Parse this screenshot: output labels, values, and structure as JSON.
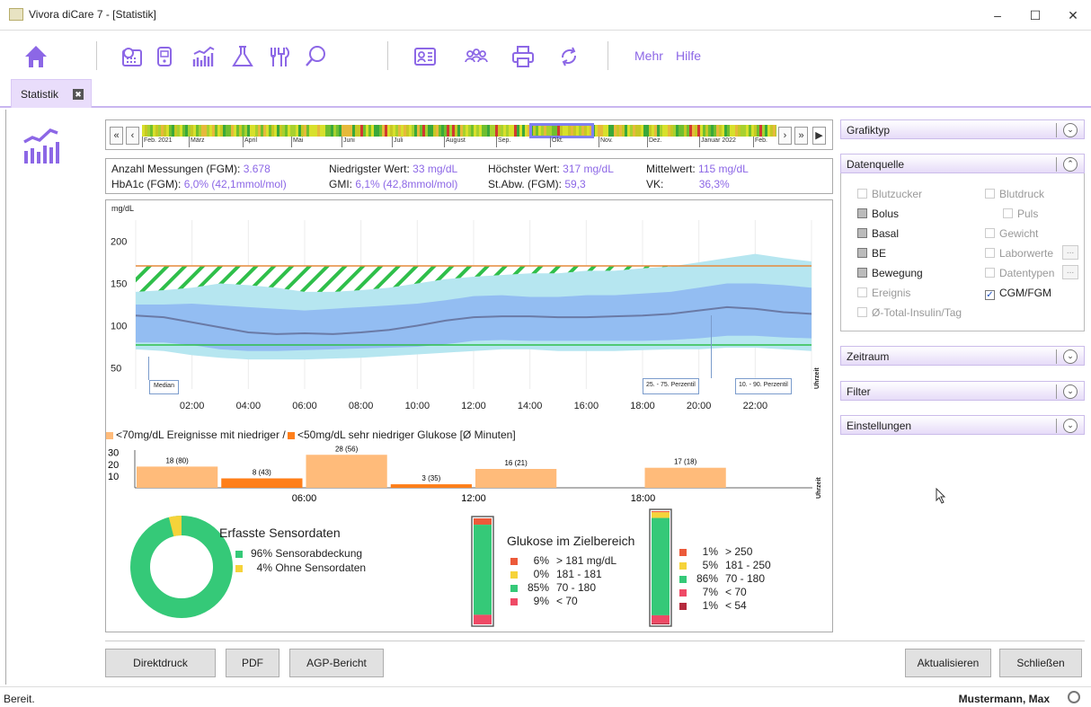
{
  "window": {
    "title": "Vivora diCare 7 - [Statistik]",
    "min": "–",
    "max": "☐",
    "close": "✕"
  },
  "toolbar": {
    "more": "Mehr",
    "help": "Hilfe"
  },
  "tab": {
    "label": "Statistik",
    "close": "✖"
  },
  "timeline": {
    "months": [
      "Feb. 2021",
      "März",
      "April",
      "Mai",
      "Juni",
      "Juli",
      "August",
      "Sep.",
      "Okt.",
      "Nov.",
      "Dez.",
      "Januar 2022",
      "Feb."
    ],
    "first": "«",
    "prev": "‹",
    "next": "›",
    "last": "»",
    "play": "▶"
  },
  "stats": {
    "count_label": "Anzahl Messungen (FGM):",
    "count_val": "3.678",
    "low_label": "Niedrigster Wert:",
    "low_val": "33 mg/dL",
    "high_label": "Höchster Wert:",
    "high_val": "317 mg/dL",
    "mean_label": "Mittelwert:",
    "mean_val": "115 mg/dL",
    "hba1c_label": "HbA1c (FGM):",
    "hba1c_val": "6,0% (42,1mmol/mol)",
    "gmi_label": "GMI:",
    "gmi_val": "6,1% (42,8mmol/mol)",
    "sd_label": "St.Abw. (FGM):",
    "sd_val": "59,3",
    "vk_label": "VK:",
    "vk_val": "36,3%"
  },
  "agp": {
    "unit": "mg/dL",
    "yticks": [
      "200",
      "150",
      "100",
      "50"
    ],
    "xticks": [
      "02:00",
      "04:00",
      "06:00",
      "08:00",
      "10:00",
      "12:00",
      "14:00",
      "16:00",
      "18:00",
      "20:00",
      "22:00"
    ],
    "xunit": "Uhrzeit",
    "median_label": "Median",
    "p25_label": "25. - 75. Perzentil",
    "p10_label": "10. - 90. Perzentil"
  },
  "events": {
    "legend1": "<70mg/dL Ereignisse mit niedriger /",
    "legend2": "<50mg/dL sehr niedriger Glukose [Ø Minuten]",
    "yticks": [
      "30",
      "20",
      "10"
    ],
    "xticks": [
      "06:00",
      "12:00",
      "18:00"
    ],
    "xunit": "Uhrzeit",
    "bars": [
      {
        "label": "18 (80)",
        "value": 18,
        "type": "low"
      },
      {
        "label": "8 (43)",
        "value": 8,
        "type": "verylow"
      },
      {
        "label": "28 (56)",
        "value": 28,
        "type": "low"
      },
      {
        "label": "3 (35)",
        "value": 3,
        "type": "verylow"
      },
      {
        "label": "16 (21)",
        "value": 16,
        "type": "low"
      },
      {
        "label": "17 (18)",
        "value": 17,
        "type": "low"
      }
    ]
  },
  "sensor": {
    "title": "Erfasste Sensordaten",
    "covered_pct": "96%",
    "covered_label": "Sensorabdeckung",
    "missing_pct": "4%",
    "missing_label": "Ohne Sensordaten",
    "covered_value": 96,
    "missing_value": 4
  },
  "target": {
    "title": "Glukose im Zielbereich",
    "left": [
      {
        "pct": "6%",
        "range": "> 181 mg/dL",
        "color": "#ec5a3a",
        "value": 6
      },
      {
        "pct": "0%",
        "range": "181 - 181",
        "color": "#f6d33a",
        "value": 0
      },
      {
        "pct": "85%",
        "range": "70 - 180",
        "color": "#35c978",
        "value": 85
      },
      {
        "pct": "9%",
        "range": "< 70",
        "color": "#ef4a66",
        "value": 9
      }
    ],
    "right": [
      {
        "pct": "1%",
        "range": "> 250",
        "color": "#ec5a3a",
        "value": 1
      },
      {
        "pct": "5%",
        "range": "181 - 250",
        "color": "#f6d33a",
        "value": 5
      },
      {
        "pct": "86%",
        "range": "70 - 180",
        "color": "#35c978",
        "value": 86
      },
      {
        "pct": "7%",
        "range": "< 70",
        "color": "#ef4a66",
        "value": 7
      },
      {
        "pct": "1%",
        "range": "< 54",
        "color": "#b52a3d",
        "value": 1
      }
    ]
  },
  "panel": {
    "grafiktyp": "Grafiktyp",
    "datenquelle": "Datenquelle",
    "zeitraum": "Zeitraum",
    "filter": "Filter",
    "einstellungen": "Einstellungen",
    "cb": {
      "blutzucker": "Blutzucker",
      "blutdruck": "Blutdruck",
      "bolus": "Bolus",
      "puls": "Puls",
      "basal": "Basal",
      "gewicht": "Gewicht",
      "be": "BE",
      "laborwerte": "Laborwerte",
      "bewegung": "Bewegung",
      "datentypen": "Datentypen",
      "ereignis": "Ereignis",
      "cgm": "CGM/FGM",
      "insulin": "Ø-Total-Insulin/Tag"
    },
    "dots": "...",
    "checkmark": "✓",
    "up": "⌃",
    "down": "⌄"
  },
  "buttons": {
    "direktdruck": "Direktdruck",
    "pdf": "PDF",
    "agp": "AGP-Bericht",
    "aktualisieren": "Aktualisieren",
    "schliessen": "Schließen"
  },
  "status": {
    "left": "Bereit.",
    "user": "Mustermann, Max"
  },
  "colors": {
    "accent": "#8c67e6",
    "outer_band": "#b6e6f0",
    "inner_band": "#93bdf2",
    "median": "#6a7aa6",
    "target_line_high": "#e68a3c",
    "target_line_low": "#2fbf4a",
    "bar_low": "#ffbb7a",
    "bar_verylow": "#ff7f1a"
  }
}
